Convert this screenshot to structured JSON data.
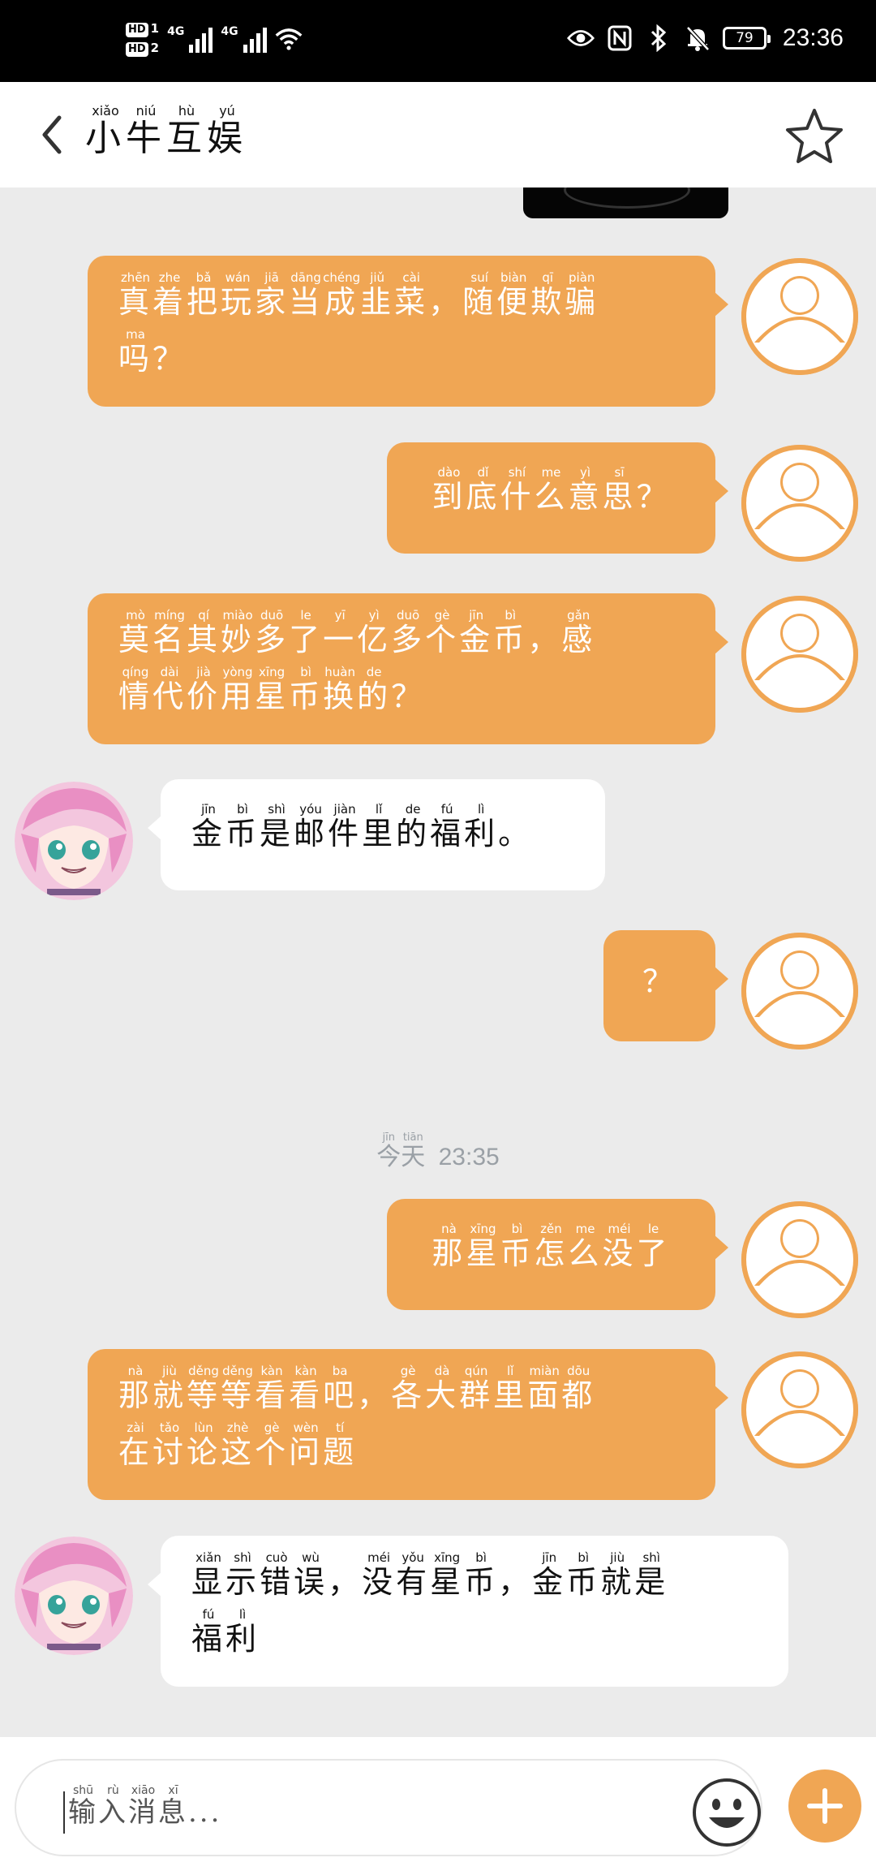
{
  "status_bar": {
    "sim1": "HD 1",
    "sim2": "HD 2",
    "net1": "4G",
    "net2": "4G",
    "battery": "79",
    "time": "23:36"
  },
  "header": {
    "title": [
      {
        "c": "小",
        "p": "xiǎo"
      },
      {
        "c": "牛",
        "p": "niú"
      },
      {
        "c": "互",
        "p": "hù"
      },
      {
        "c": "娱",
        "p": "yú"
      }
    ]
  },
  "colors": {
    "accent": "#f0a654",
    "bg": "#ebebeb"
  },
  "messages": [
    {
      "side": "me",
      "lines": [
        [
          {
            "c": "真",
            "p": "zhēn"
          },
          {
            "c": "着",
            "p": "zhe"
          },
          {
            "c": "把",
            "p": "bǎ"
          },
          {
            "c": "玩",
            "p": "wán"
          },
          {
            "c": "家",
            "p": "jiā"
          },
          {
            "c": "当",
            "p": "dāng"
          },
          {
            "c": "成",
            "p": "chéng"
          },
          {
            "c": "韭",
            "p": "jiǔ"
          },
          {
            "c": "菜",
            "p": "cài"
          },
          {
            "c": "，",
            "p": ""
          },
          {
            "c": "随",
            "p": "suí"
          },
          {
            "c": "便",
            "p": "biàn"
          },
          {
            "c": "欺",
            "p": "qī"
          },
          {
            "c": "骗",
            "p": "piàn"
          }
        ],
        [
          {
            "c": "吗",
            "p": "ma"
          },
          {
            "c": "？",
            "p": ""
          }
        ]
      ]
    },
    {
      "side": "me",
      "lines": [
        [
          {
            "c": "到",
            "p": "dào"
          },
          {
            "c": "底",
            "p": "dǐ"
          },
          {
            "c": "什",
            "p": "shí"
          },
          {
            "c": "么",
            "p": "me"
          },
          {
            "c": "意",
            "p": "yì"
          },
          {
            "c": "思",
            "p": "sī"
          },
          {
            "c": "？",
            "p": ""
          }
        ]
      ]
    },
    {
      "side": "me",
      "lines": [
        [
          {
            "c": "莫",
            "p": "mò"
          },
          {
            "c": "名",
            "p": "míng"
          },
          {
            "c": "其",
            "p": "qí"
          },
          {
            "c": "妙",
            "p": "miào"
          },
          {
            "c": "多",
            "p": "duō"
          },
          {
            "c": "了",
            "p": "le"
          },
          {
            "c": "一",
            "p": "yī"
          },
          {
            "c": "亿",
            "p": "yì"
          },
          {
            "c": "多",
            "p": "duō"
          },
          {
            "c": "个",
            "p": "gè"
          },
          {
            "c": "金",
            "p": "jīn"
          },
          {
            "c": "币",
            "p": "bì"
          },
          {
            "c": "，",
            "p": ""
          },
          {
            "c": "感",
            "p": "gǎn"
          }
        ],
        [
          {
            "c": "情",
            "p": "qíng"
          },
          {
            "c": "代",
            "p": "dài"
          },
          {
            "c": "价",
            "p": "jià"
          },
          {
            "c": "用",
            "p": "yòng"
          },
          {
            "c": "星",
            "p": "xīng"
          },
          {
            "c": "币",
            "p": "bì"
          },
          {
            "c": "换",
            "p": "huàn"
          },
          {
            "c": "的",
            "p": "de"
          },
          {
            "c": "？",
            "p": ""
          }
        ]
      ]
    },
    {
      "side": "other",
      "lines": [
        [
          {
            "c": "金",
            "p": "jīn"
          },
          {
            "c": "币",
            "p": "bì"
          },
          {
            "c": "是",
            "p": "shì"
          },
          {
            "c": "邮",
            "p": "yóu"
          },
          {
            "c": "件",
            "p": "jiàn"
          },
          {
            "c": "里",
            "p": "lǐ"
          },
          {
            "c": "的",
            "p": "de"
          },
          {
            "c": "福",
            "p": "fú"
          },
          {
            "c": "利",
            "p": "lì"
          },
          {
            "c": "。",
            "p": ""
          }
        ]
      ]
    },
    {
      "side": "me",
      "lines": [
        [
          {
            "c": "？",
            "p": ""
          }
        ]
      ]
    },
    {
      "side": "me",
      "lines": [
        [
          {
            "c": "那",
            "p": "nà"
          },
          {
            "c": "星",
            "p": "xīng"
          },
          {
            "c": "币",
            "p": "bì"
          },
          {
            "c": "怎",
            "p": "zěn"
          },
          {
            "c": "么",
            "p": "me"
          },
          {
            "c": "没",
            "p": "méi"
          },
          {
            "c": "了",
            "p": "le"
          }
        ]
      ]
    },
    {
      "side": "me",
      "lines": [
        [
          {
            "c": "那",
            "p": "nà"
          },
          {
            "c": "就",
            "p": "jiù"
          },
          {
            "c": "等",
            "p": "děng"
          },
          {
            "c": "等",
            "p": "děng"
          },
          {
            "c": "看",
            "p": "kàn"
          },
          {
            "c": "看",
            "p": "kàn"
          },
          {
            "c": "吧",
            "p": "ba"
          },
          {
            "c": "，",
            "p": ""
          },
          {
            "c": "各",
            "p": "gè"
          },
          {
            "c": "大",
            "p": "dà"
          },
          {
            "c": "群",
            "p": "qún"
          },
          {
            "c": "里",
            "p": "lǐ"
          },
          {
            "c": "面",
            "p": "miàn"
          },
          {
            "c": "都",
            "p": "dōu"
          }
        ],
        [
          {
            "c": "在",
            "p": "zài"
          },
          {
            "c": "讨",
            "p": "tǎo"
          },
          {
            "c": "论",
            "p": "lùn"
          },
          {
            "c": "这",
            "p": "zhè"
          },
          {
            "c": "个",
            "p": "gè"
          },
          {
            "c": "问",
            "p": "wèn"
          },
          {
            "c": "题",
            "p": "tí"
          }
        ]
      ]
    },
    {
      "side": "other",
      "lines": [
        [
          {
            "c": "显",
            "p": "xiǎn"
          },
          {
            "c": "示",
            "p": "shì"
          },
          {
            "c": "错",
            "p": "cuò"
          },
          {
            "c": "误",
            "p": "wù"
          },
          {
            "c": "，",
            "p": ""
          },
          {
            "c": "没",
            "p": "méi"
          },
          {
            "c": "有",
            "p": "yǒu"
          },
          {
            "c": "星",
            "p": "xīng"
          },
          {
            "c": "币",
            "p": "bì"
          },
          {
            "c": "，",
            "p": ""
          },
          {
            "c": "金",
            "p": "jīn"
          },
          {
            "c": "币",
            "p": "bì"
          },
          {
            "c": "就",
            "p": "jiù"
          },
          {
            "c": "是",
            "p": "shì"
          }
        ],
        [
          {
            "c": "福",
            "p": "fú"
          },
          {
            "c": "利",
            "p": "lì"
          }
        ]
      ]
    }
  ],
  "timestamp": {
    "day": [
      {
        "c": "今",
        "p": "jīn"
      },
      {
        "c": "天",
        "p": "tiān"
      }
    ],
    "time": "23:35"
  },
  "input": {
    "placeholder": [
      {
        "c": "输",
        "p": "shū"
      },
      {
        "c": "入",
        "p": "rù"
      },
      {
        "c": "消",
        "p": "xiāo"
      },
      {
        "c": "息",
        "p": "xī"
      },
      {
        "c": "...",
        "p": ""
      }
    ]
  }
}
